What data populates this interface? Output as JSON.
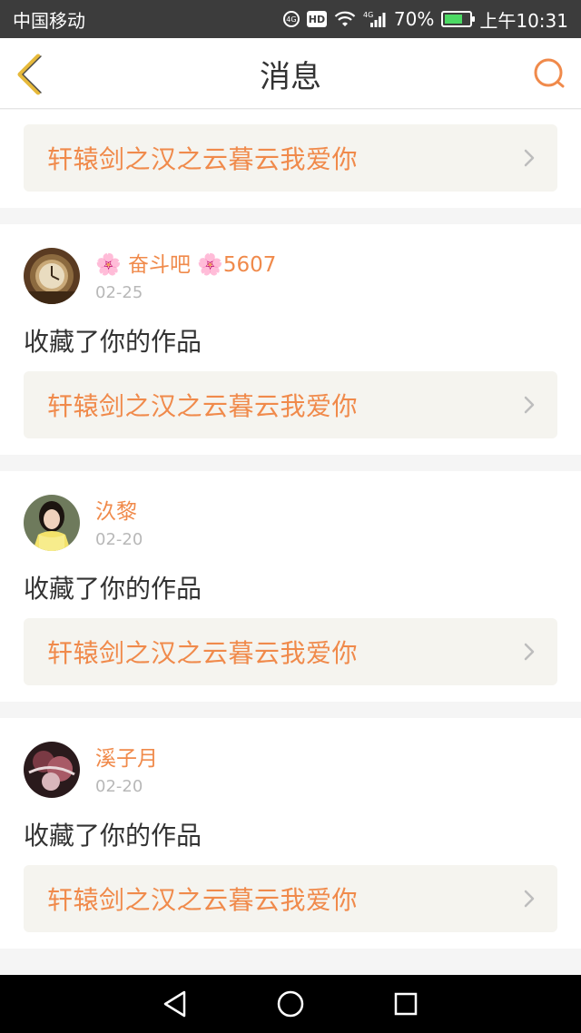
{
  "status_bar": {
    "carrier": "中国移动",
    "network": "4G",
    "battery": "70%",
    "battery_level": 0.7,
    "time": "上午10:31",
    "hd_label": "HD"
  },
  "header": {
    "title": "消息"
  },
  "first_card": {
    "work_title": "轩辕剑之汉之云暮云我爱你"
  },
  "messages": [
    {
      "user": "🌸 奋斗吧 🌸5607",
      "date": "02-25",
      "action": "收藏了你的作品",
      "work_title": "轩辕剑之汉之云暮云我爱你"
    },
    {
      "user": "汣黎",
      "date": "02-20",
      "action": "收藏了你的作品",
      "work_title": "轩辕剑之汉之云暮云我爱你"
    },
    {
      "user": "溪子月",
      "date": "02-20",
      "action": "收藏了你的作品",
      "work_title": "轩辕剑之汉之云暮云我爱你"
    }
  ],
  "colors": {
    "accent": "#f08a4b",
    "back_icon": "#e6b93a",
    "status_bg": "#3c3c3c",
    "card_link_bg": "#f5f4ef"
  }
}
